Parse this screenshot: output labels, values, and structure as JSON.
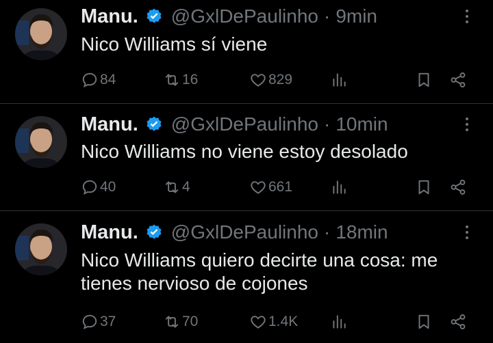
{
  "colors": {
    "background": "#000000",
    "text_primary": "#e7e9ea",
    "text_secondary": "#71767b",
    "verified_badge": "#1d9bf0",
    "divider": "#2f3336"
  },
  "tweets": [
    {
      "author_name": "Manu.",
      "handle": "@GxlDePaulinho",
      "separator": "·",
      "time": "9min",
      "text": "Nico Williams sí viene",
      "reply_count": "84",
      "retweet_count": "16",
      "like_count": "829",
      "icons": [
        "reply-icon",
        "retweet-icon",
        "like-icon",
        "views-icon",
        "bookmark-icon",
        "share-icon",
        "more-icon",
        "verified-icon"
      ]
    },
    {
      "author_name": "Manu.",
      "handle": "@GxlDePaulinho",
      "separator": "·",
      "time": "10min",
      "text": "Nico Williams no viene estoy desolado",
      "reply_count": "40",
      "retweet_count": "4",
      "like_count": "661"
    },
    {
      "author_name": "Manu.",
      "handle": "@GxlDePaulinho",
      "separator": "·",
      "time": "18min",
      "text": "Nico Williams quiero decirte una cosa: me tienes nervioso de cojones",
      "reply_count": "37",
      "retweet_count": "70",
      "like_count": "1.4K"
    }
  ]
}
